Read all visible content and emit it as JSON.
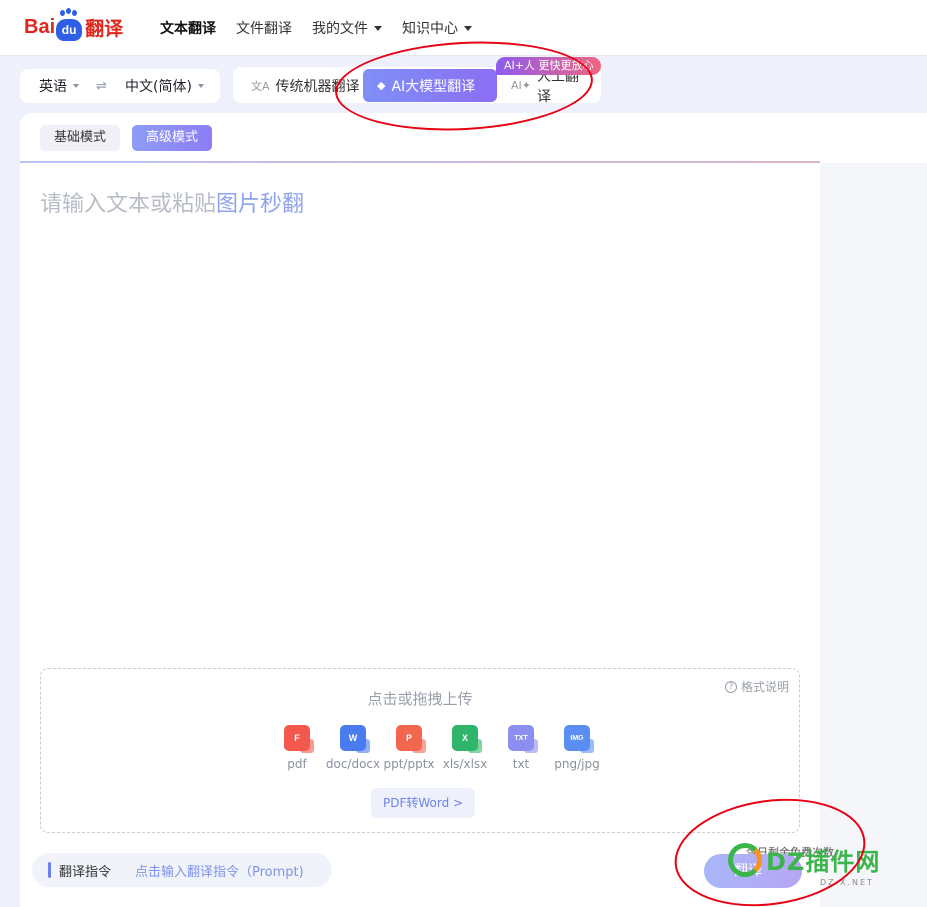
{
  "header": {
    "logo": {
      "bai": "Bai",
      "du": "du",
      "fanyi": "翻译"
    },
    "nav": [
      {
        "label": "文本翻译",
        "active": true,
        "dropdown": false
      },
      {
        "label": "文件翻译",
        "active": false,
        "dropdown": false
      },
      {
        "label": "我的文件",
        "active": false,
        "dropdown": true
      },
      {
        "label": "知识中心",
        "active": false,
        "dropdown": true
      }
    ]
  },
  "lang": {
    "source": "英语",
    "swap_icon": "⇌",
    "target": "中文(简体)"
  },
  "modes": {
    "machine": "传统机器翻译",
    "ai": "AI大模型翻译",
    "human": "人工翻译",
    "human_badge": "AI+人 更快更放心"
  },
  "submodes": {
    "basic": "基础模式",
    "advanced": "高级模式"
  },
  "source": {
    "placeholder": "请输入文本或粘贴",
    "placeholder_link": "图片秒翻"
  },
  "upload": {
    "title": "点击或拖拽上传",
    "format_help": "格式说明",
    "types": [
      {
        "label": "pdf",
        "letter": "F",
        "color": "#f3584f"
      },
      {
        "label": "doc/docx",
        "letter": "W",
        "color": "#4a7cf0"
      },
      {
        "label": "ppt/pptx",
        "letter": "P",
        "color": "#f26650"
      },
      {
        "label": "xls/xlsx",
        "letter": "X",
        "color": "#2fb56a"
      },
      {
        "label": "txt",
        "letter": "TXT",
        "color": "#8c8ff0"
      },
      {
        "label": "png/jpg",
        "letter": "IMG",
        "color": "#5b8ef2"
      }
    ],
    "pdf_to_word": "PDF转Word >"
  },
  "prompt": {
    "label": "翻译指令",
    "placeholder": "点击输入翻译指令（Prompt)"
  },
  "footer": {
    "quota": "今日剩余免费次数",
    "translate": "翻译"
  },
  "watermark": {
    "text": "DZ插件网",
    "sub": "DZ-X.NET"
  }
}
